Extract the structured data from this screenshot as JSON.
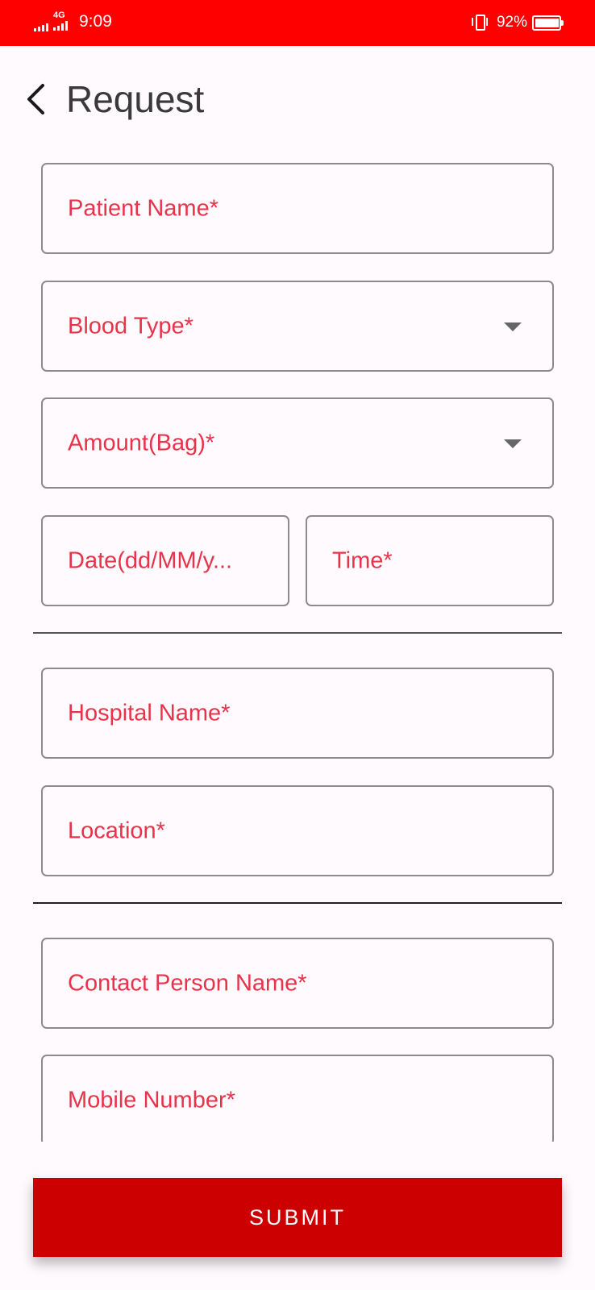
{
  "status_bar": {
    "time": "9:09",
    "network": "4G",
    "battery": "92%",
    "background_color": "#ff0000"
  },
  "header": {
    "back_icon": "chevron-left-icon",
    "title": "Request"
  },
  "form": {
    "patient_name": {
      "label": "Patient Name*"
    },
    "blood_type": {
      "label": "Blood Type*",
      "icon": "dropdown-arrow-icon"
    },
    "amount": {
      "label": "Amount(Bag)*",
      "icon": "dropdown-arrow-icon"
    },
    "date": {
      "label": "Date(dd/MM/y..."
    },
    "time": {
      "label": "Time*"
    },
    "hospital_name": {
      "label": "Hospital Name*"
    },
    "location": {
      "label": "Location*"
    },
    "contact_person": {
      "label": "Contact Person Name*"
    },
    "mobile_number": {
      "label": "Mobile Number*"
    }
  },
  "submit": {
    "label": "SUBMIT",
    "color": "#cc0000"
  },
  "colors": {
    "label": "#e8334a",
    "border": "#8c8c8c",
    "title": "#3a3a3a",
    "background": "#fefafd"
  }
}
